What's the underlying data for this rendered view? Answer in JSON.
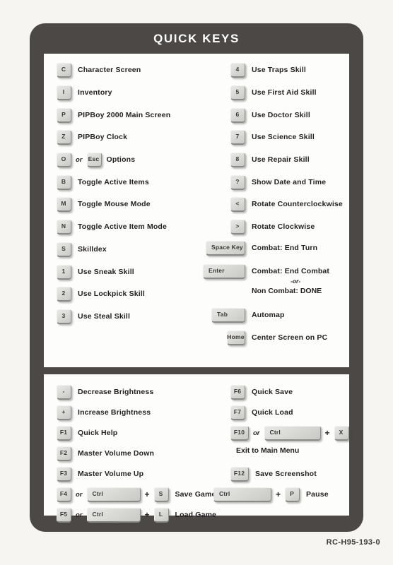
{
  "card": {
    "title": "QUICK KEYS",
    "frame_color": "#4b4845",
    "panel_color": "#fdfdfb",
    "key_color": "#dcdcd9",
    "text_color": "#231f20"
  },
  "words": {
    "or": "or",
    "plus": "+",
    "or_italic": "-or-"
  },
  "sections": [
    {
      "id": "gameplay",
      "left_rows": [
        {
          "keys": [
            "C"
          ],
          "label": "Character Screen"
        },
        {
          "keys": [
            "I"
          ],
          "label": "Inventory"
        },
        {
          "keys": [
            "P"
          ],
          "label": "PIPBoy 2000 Main Screen"
        },
        {
          "keys": [
            "Z"
          ],
          "label": "PIPBoy Clock"
        },
        {
          "keys": [
            "O",
            "Esc"
          ],
          "label": "Options"
        },
        {
          "keys": [
            "B"
          ],
          "label": "Toggle Active Items"
        },
        {
          "keys": [
            "M"
          ],
          "label": "Toggle Mouse Mode"
        },
        {
          "keys": [
            "N"
          ],
          "label": "Toggle Active Item Mode"
        },
        {
          "keys": [
            "S"
          ],
          "label": "Skilldex"
        },
        {
          "keys": [
            "1"
          ],
          "label": "Use Sneak Skill"
        },
        {
          "keys": [
            "2"
          ],
          "label": "Use Lockpick Skill"
        },
        {
          "keys": [
            "3"
          ],
          "label": "Use Steal Skill"
        }
      ],
      "right_rows": [
        {
          "keys": [
            "4"
          ],
          "label": "Use Traps Skill"
        },
        {
          "keys": [
            "5"
          ],
          "label": "Use First Aid Skill"
        },
        {
          "keys": [
            "6"
          ],
          "label": "Use Doctor Skill"
        },
        {
          "keys": [
            "7"
          ],
          "label": "Use Science Skill"
        },
        {
          "keys": [
            "8"
          ],
          "label": "Use Repair Skill"
        },
        {
          "keys": [
            "?"
          ],
          "label": "Show Date and Time"
        },
        {
          "keys": [
            "<"
          ],
          "label": "Rotate Counterclockwise"
        },
        {
          "keys": [
            ">"
          ],
          "label": "Rotate Clockwise"
        },
        {
          "keys": [
            "Space Key"
          ],
          "label": "Combat: End Turn"
        },
        {
          "keys": [
            "Enter"
          ],
          "label": "Combat: End Combat"
        },
        {
          "keys": [
            "Tab"
          ],
          "label": "Automap"
        },
        {
          "keys": [
            "Home"
          ],
          "label": "Center Screen on PC"
        }
      ],
      "notes": [
        {
          "text": "-or-",
          "style": "small"
        },
        {
          "text": "Non Combat: DONE",
          "style": "normal"
        }
      ]
    },
    {
      "id": "system",
      "left_rows": [
        {
          "keys": [
            "-"
          ],
          "label": "Decrease Brightness"
        },
        {
          "keys": [
            "+"
          ],
          "label": "Increase Brightness"
        },
        {
          "keys": [
            "F1"
          ],
          "label": "Quick Help"
        },
        {
          "keys": [
            "F2"
          ],
          "label": "Master Volume Down"
        },
        {
          "keys": [
            "F3"
          ],
          "label": "Master Volume Up"
        },
        {
          "keys": [
            "F4",
            "Ctrl",
            "S"
          ],
          "label": "Save Game"
        },
        {
          "keys": [
            "F5",
            "Ctrl",
            "L"
          ],
          "label": "Load Game"
        }
      ],
      "right_rows": [
        {
          "keys": [
            "F6"
          ],
          "label": "Quick Save"
        },
        {
          "keys": [
            "F7"
          ],
          "label": "Quick Load"
        },
        {
          "keys": [
            "F10",
            "Ctrl",
            "X"
          ],
          "label": ""
        },
        {
          "keys": [
            "F12"
          ],
          "label": "Save Screenshot"
        },
        {
          "keys": [
            "Ctrl",
            "P"
          ],
          "label": "Pause"
        }
      ],
      "notes": [
        {
          "text": "Exit to Main Menu",
          "style": "normal"
        }
      ]
    }
  ],
  "footer": {
    "code": "RC-H95-193-0"
  }
}
